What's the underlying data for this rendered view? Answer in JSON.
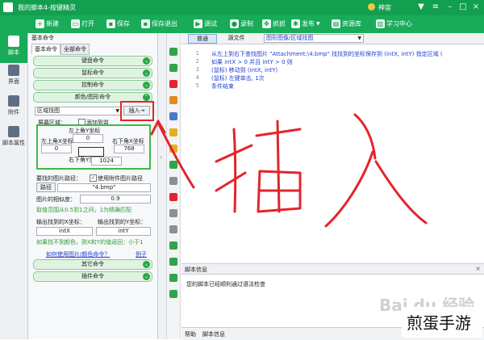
{
  "titlebar": {
    "title": "我的脚本4-按键精灵",
    "member_label": "神宙"
  },
  "toolbar": {
    "new": "新建",
    "open": "打开",
    "save": "保存",
    "save_exit": "保存退出",
    "debug": "调试",
    "record": "录制",
    "capture": "抓抓",
    "publish": "发布",
    "resource": "资源库",
    "study": "学习中心"
  },
  "rail": {
    "script": "脚本",
    "ui": "界面",
    "attach": "附件",
    "props": "脚本属性"
  },
  "panel": {
    "header": "基本命令",
    "tab_basic": "基本命令",
    "tab_all": "全部命令",
    "cat_keyboard": "键盘命令",
    "cat_mouse": "鼠标命令",
    "cat_control": "控制命令",
    "cat_color": "颜色/图形命令",
    "cmd_select": "区域找图",
    "insert_btn": "插入→",
    "screen_region": "屏幕区域：",
    "add_monitor": "添加到监",
    "top_left_y": "左上角Y坐标",
    "top_left_x": "左上角X坐标",
    "bottom_right_x": "右下角X坐标",
    "bottom_right_y": "右下角Y坐标",
    "v_tlx": "0",
    "v_tly": "0",
    "v_brx": "768",
    "v_bry": "1024",
    "find_path": "要找的图片路径：",
    "use_attach": "使用附件图片路径",
    "browse": "路径",
    "path_value": "\"4.bmp\"",
    "similarity": "图片的相似度：",
    "similarity_value": "0.9",
    "sim_hint": "取值范围从0.5到1之间，1为精确匹配",
    "out_x": "输出找到的X坐标：",
    "out_y": "输出找到的Y坐标：",
    "out_x_var": "intX",
    "out_y_var": "intY",
    "not_found": "如果找不到颜色，则X和Y的值返回：小于1",
    "how_use": "如何使用图片/颜色命令？",
    "example": "例子",
    "cat_other": "其它命令",
    "cat_plugin": "插件命令"
  },
  "editor": {
    "tab_normal": "普通",
    "tab_source": "源文件",
    "dropdown": "图形图像/区域找图",
    "lines": [
      "从左上到右下查找图片 \"Attachment:\\4.bmp\" 找找到的坐标保存到 (intX, intY) 指定区域 (",
      "如果 intX > 0 并且 intY > 0 则",
      "  (鼠标) 移动到 (intX, intY)",
      "  (鼠标) 左键单击, 1次",
      "条件结束"
    ],
    "line_numbers": [
      "1",
      "2",
      "3",
      "4",
      "5"
    ]
  },
  "info": {
    "title": "脚本信息",
    "message": "您的脚本已经顺利通过语法检查",
    "tab_help": "帮助",
    "tab_info": "脚本信息"
  },
  "overlay": {
    "handwriting": "插入",
    "watermark": "Bai du 经验",
    "corner_brand": "煎蛋手游"
  },
  "colors": {
    "accent": "#18ab58",
    "annotation": "#e3242b",
    "code": "#1f3fd0"
  }
}
